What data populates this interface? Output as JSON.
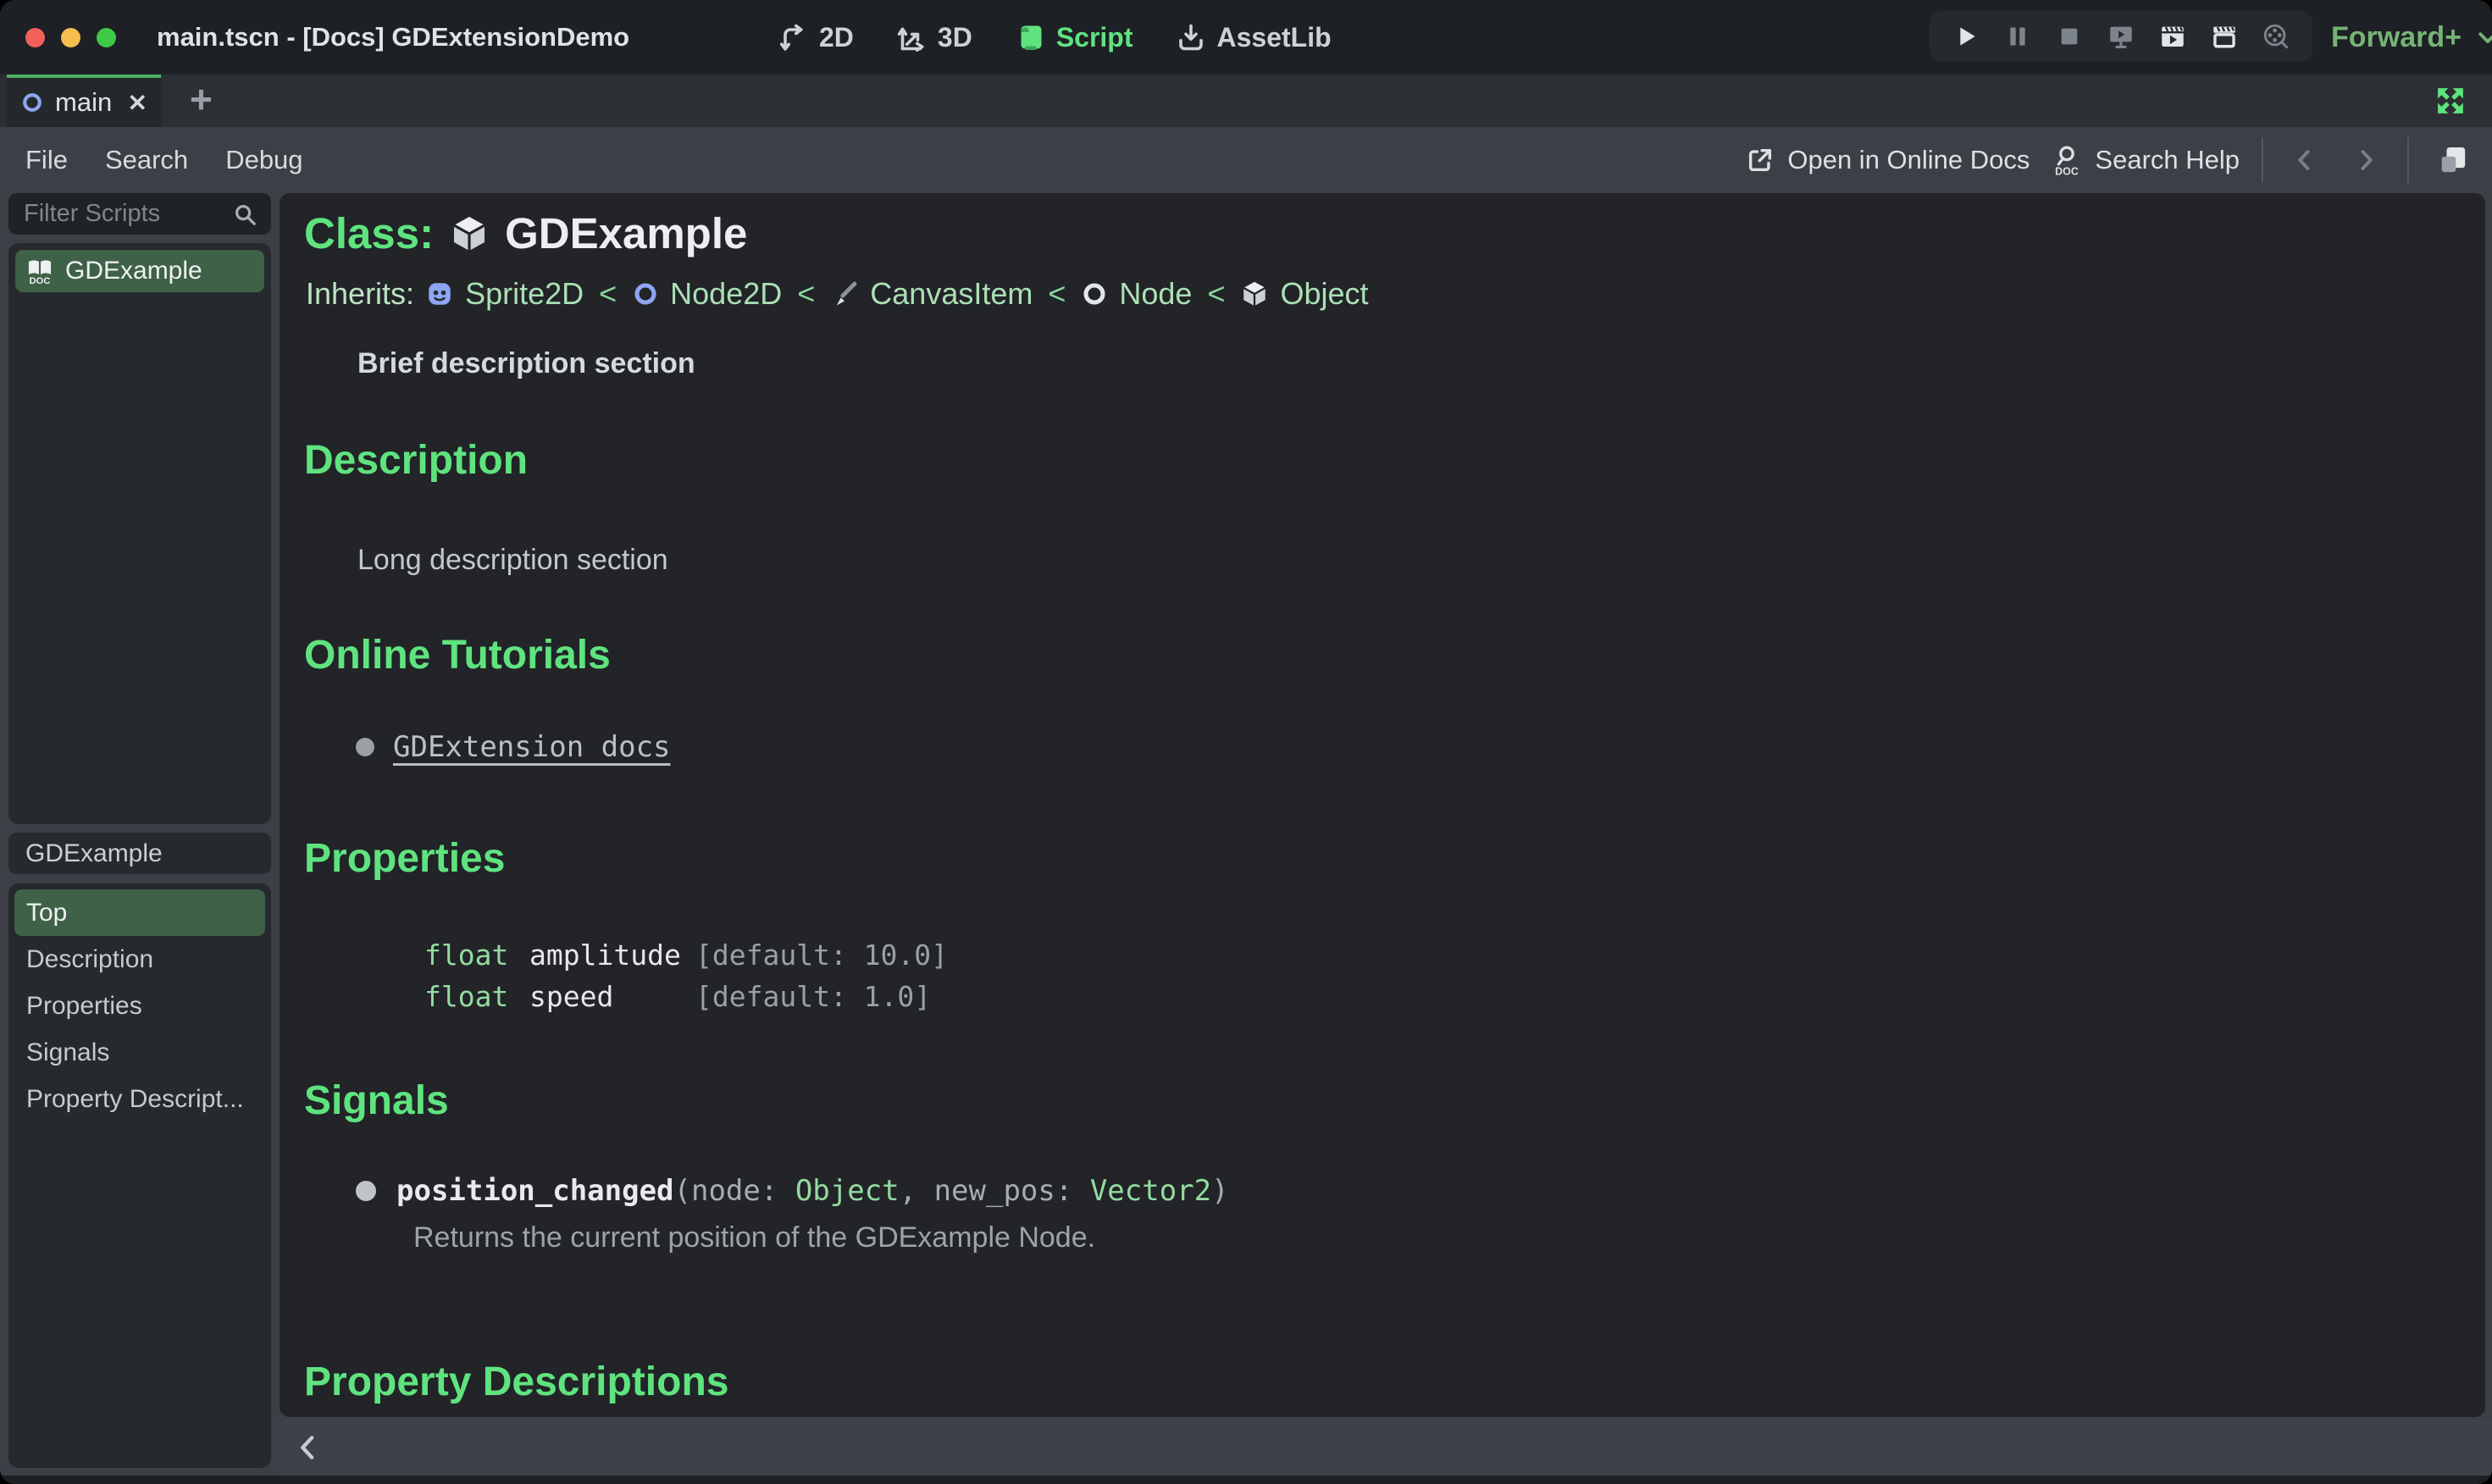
{
  "window": {
    "title": "main.tscn - [Docs] GDExtensionDemo"
  },
  "titlebar": {
    "workspaces": [
      {
        "label": "2D"
      },
      {
        "label": "3D"
      },
      {
        "label": "Script"
      },
      {
        "label": "AssetLib"
      }
    ],
    "run_controls": [
      "play",
      "pause",
      "stop",
      "play-remote",
      "play-scene",
      "play-custom-scene",
      "movie-maker"
    ],
    "renderer": {
      "label": "Forward+"
    }
  },
  "tabbar": {
    "tabs": [
      {
        "label": "main"
      }
    ],
    "add_label": "+"
  },
  "menubar": {
    "items": [
      {
        "label": "File"
      },
      {
        "label": "Search"
      },
      {
        "label": "Debug"
      }
    ],
    "online_docs": "Open in Online Docs",
    "search_help": "Search Help"
  },
  "sidebar": {
    "filter_placeholder": "Filter Scripts",
    "scripts": [
      {
        "label": "GDExample"
      }
    ],
    "selected_class": "GDExample",
    "members": [
      {
        "label": "Top"
      },
      {
        "label": "Description"
      },
      {
        "label": "Properties"
      },
      {
        "label": "Signals"
      },
      {
        "label": "Property Descript..."
      }
    ]
  },
  "doc": {
    "class_label": "Class:",
    "class_name": "GDExample",
    "inherits_label": "Inherits:",
    "inherits": [
      {
        "name": "Sprite2D",
        "sep": "<"
      },
      {
        "name": "Node2D",
        "sep": "<"
      },
      {
        "name": "CanvasItem",
        "sep": "<"
      },
      {
        "name": "Node",
        "sep": "<"
      },
      {
        "name": "Object",
        "sep": ""
      }
    ],
    "brief": "Brief description section",
    "description_heading": "Description",
    "long_description": "Long description section",
    "tutorials_heading": "Online Tutorials",
    "tutorial_link": "GDExtension docs",
    "properties_heading": "Properties",
    "properties": [
      {
        "type": "float",
        "name": "amplitude",
        "default": "[default: 10.0]"
      },
      {
        "type": "float",
        "name": "speed",
        "default": "[default: 1.0]"
      }
    ],
    "signals_heading": "Signals",
    "signal": {
      "name": "position_changed",
      "p1": "(node: ",
      "t1": "Object",
      "p2": ", new_pos: ",
      "t2": "Vector2",
      "p3": ")",
      "description": "Returns the current position of the GDExample Node."
    },
    "property_descriptions_heading": "Property Descriptions"
  },
  "colors": {
    "accent_green": "#5fe37f",
    "selection_green": "#3f6147",
    "renderer_green": "#76b375",
    "tab_active_border": "#4cb05f",
    "content_bg": "#222428",
    "chrome_bg": "#3c4046",
    "titlebar_bg": "#1d2024"
  }
}
